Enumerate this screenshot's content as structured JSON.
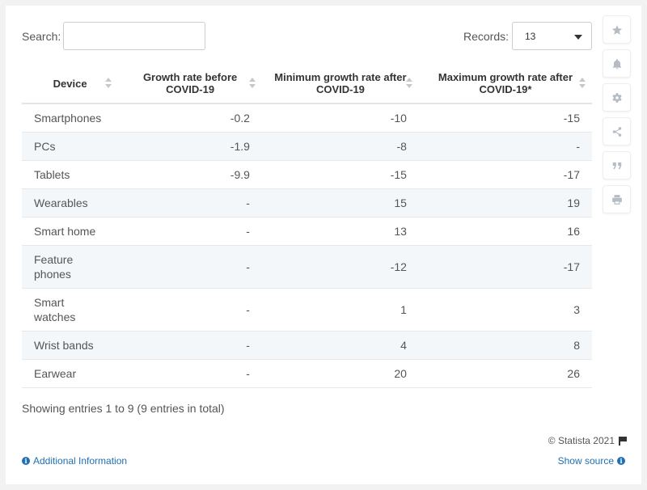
{
  "search": {
    "label": "Search:",
    "value": "",
    "placeholder": ""
  },
  "records": {
    "label": "Records:",
    "value": "13"
  },
  "table": {
    "headers": [
      "Device",
      "Growth rate before COVID-19",
      "Minimum growth rate after COVID-19",
      "Maximum growth rate after COVID-19*"
    ],
    "rows": [
      [
        "Smartphones",
        "-0.2",
        "-10",
        "-15"
      ],
      [
        "PCs",
        "-1.9",
        "-8",
        "-"
      ],
      [
        "Tablets",
        "-9.9",
        "-15",
        "-17"
      ],
      [
        "Wearables",
        "-",
        "15",
        "19"
      ],
      [
        "Smart home",
        "-",
        "13",
        "16"
      ],
      [
        "Feature phones",
        "-",
        "-12",
        "-17"
      ],
      [
        "Smart watches",
        "-",
        "1",
        "3"
      ],
      [
        "Wrist bands",
        "-",
        "4",
        "8"
      ],
      [
        "Earwear",
        "-",
        "20",
        "26"
      ]
    ]
  },
  "footer": {
    "entries": "Showing entries 1 to 9 (9 entries in total)",
    "copyright": "© Statista 2021",
    "additional_info": "Additional Information",
    "show_source": "Show source"
  },
  "tools": [
    "star-icon",
    "bell-icon",
    "gear-icon",
    "share-icon",
    "quote-icon",
    "print-icon"
  ]
}
